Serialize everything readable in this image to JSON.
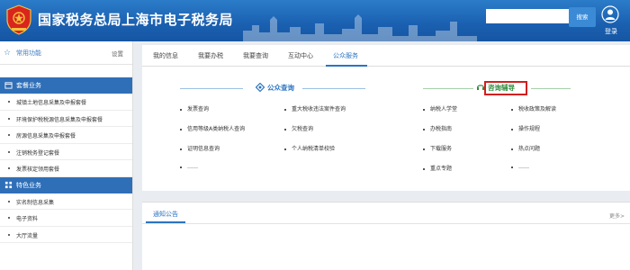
{
  "header": {
    "title": "国家税务总局上海市电子税务局",
    "search_placeholder": "",
    "search_button": "搜索",
    "login": "登录"
  },
  "sidebar": {
    "favorites_label": "常用功能",
    "settings_label": "设置",
    "groups": [
      {
        "label": "套餐业务",
        "items": [
          "城镇土地信息采集及申报套餐",
          "环境保护税税源信息采集及申报套餐",
          "房源信息采集及申报套餐",
          "注销税务登记套餐",
          "发票核定领用套餐"
        ]
      },
      {
        "label": "特色业务",
        "items": [
          "实名制信息采集",
          "电子资料",
          "大厅流量"
        ]
      }
    ]
  },
  "tabs": [
    "我的信息",
    "我要办税",
    "我要查询",
    "互动中心",
    "公众服务"
  ],
  "active_tab": "公众服务",
  "sections": {
    "query": {
      "title": "公众查询",
      "links": [
        [
          "发票查询",
          "重大税收违法案件查询"
        ],
        [
          "信用等级A类纳税人查询",
          "欠税查询"
        ],
        [
          "证明信息查询",
          "个人纳税清单校验"
        ],
        [
          "……",
          ""
        ]
      ]
    },
    "consult": {
      "title": "咨询辅导",
      "links": [
        [
          "纳税人学堂",
          "税收政策及解读"
        ],
        [
          "办税指南",
          "操作规程"
        ],
        [
          "下载服务",
          "热点问题"
        ],
        [
          "重点专题",
          "……"
        ]
      ]
    }
  },
  "notice": {
    "title": "通知公告",
    "more": "更多>"
  },
  "colors": {
    "brand_blue": "#2b74c2",
    "consult_green": "#2e8b3a",
    "highlight_red": "#d21f1f"
  }
}
